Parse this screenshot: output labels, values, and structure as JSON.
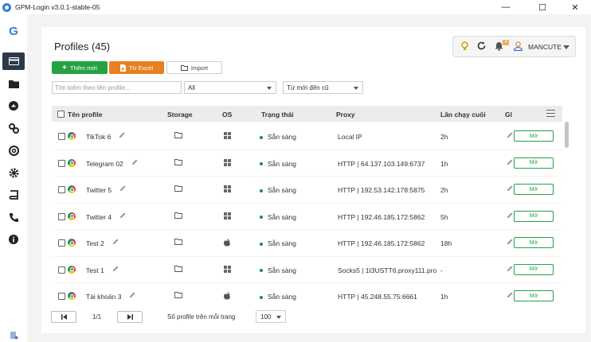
{
  "window": {
    "title": "GPM-Login v3.0.1-stable-05",
    "minimize": "—",
    "maximize": "☐",
    "close": "✕"
  },
  "colors": {
    "accent_green": "#25a244",
    "accent_orange": "#e7811f",
    "sidebar_active": "#2b3a4a",
    "status_ready": "#1e8e3e"
  },
  "sidebar": {
    "logo": "G",
    "items": [
      {
        "icon": "profiles-card-icon",
        "active": true
      },
      {
        "icon": "folder-icon"
      },
      {
        "icon": "upload-circle-icon"
      },
      {
        "icon": "link-icon"
      },
      {
        "icon": "lifebuoy-icon"
      },
      {
        "icon": "gear-icon"
      },
      {
        "icon": "book-icon"
      },
      {
        "icon": "phone-icon"
      },
      {
        "icon": "info-icon"
      }
    ],
    "bottom_icon": "user-settings-icon"
  },
  "header": {
    "title": "Profiles (45)"
  },
  "user": {
    "name": "MANCUTE",
    "notification_count": "4"
  },
  "toolbar": {
    "add_label": "Thêm mới",
    "excel_label": "Từ Excel",
    "import_label": "Import"
  },
  "filters": {
    "search_placeholder": "Tìm kiếm theo tên profile...",
    "group_value": "All",
    "sort_value": "Từ mới đến cũ"
  },
  "table": {
    "headers": {
      "name": "Tên profile",
      "storage": "Storage",
      "os": "OS",
      "status": "Trạng thái",
      "proxy": "Proxy",
      "last_run": "Lần chạy cuối",
      "note": "Gl"
    },
    "open_label": "Mở",
    "rows": [
      {
        "name": "TikTok 6",
        "os": "windows",
        "status": "Sẵn sàng",
        "proxy": "Local IP",
        "last_run": "2h"
      },
      {
        "name": "Telegram 02",
        "os": "windows",
        "status": "Sẵn sàng",
        "proxy": "HTTP | 64.137.103.149:6737",
        "last_run": "1h"
      },
      {
        "name": "Twitter 5",
        "os": "windows",
        "status": "Sẵn sàng",
        "proxy": "HTTP | 192.53.142.178:5875",
        "last_run": "2h"
      },
      {
        "name": "Twitter 4",
        "os": "windows",
        "status": "Sẵn sàng",
        "proxy": "HTTP | 192.46.185.172:5862",
        "last_run": "5h"
      },
      {
        "name": "Test 2",
        "os": "apple",
        "status": "Sẵn sàng",
        "proxy": "HTTP | 192.46.185.172:5862",
        "last_run": "18h"
      },
      {
        "name": "Test 1",
        "os": "windows",
        "status": "Sẵn sàng",
        "proxy": "Socks5 | 1t3USTT6.proxy111.pro",
        "last_run": "-"
      },
      {
        "name": "Tài khoản 3",
        "os": "apple",
        "status": "Sẵn sàng",
        "proxy": "HTTP | 45.248.55.75:6661",
        "last_run": "1h"
      }
    ]
  },
  "pagination": {
    "page": "1/1",
    "per_page_label": "Số profile trên mỗi trang",
    "per_page_value": "100"
  }
}
